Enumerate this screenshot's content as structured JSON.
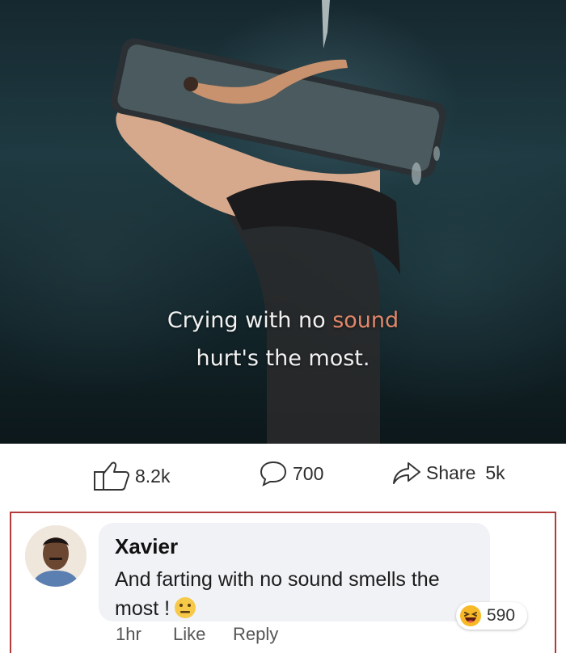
{
  "post": {
    "caption_line1_pre": "Crying with no ",
    "caption_line1_accent": "sound",
    "caption_line2": "hurt's the most."
  },
  "actions": {
    "likes": "8.2k",
    "comments": "700",
    "share_label": "Share",
    "shares": "5k"
  },
  "comment": {
    "author": "Xavier",
    "text": "And farting with no sound smells the most !",
    "time": "1hr",
    "like_label": "Like",
    "reply_label": "Reply",
    "reaction_count": "590",
    "reaction_icon": "haha-reaction-icon",
    "inline_emoji": "neutral-face-emoji"
  },
  "colors": {
    "caption_accent": "#e2876a",
    "highlight_frame": "#b23a3a",
    "bubble_bg": "#f0f2f5"
  }
}
